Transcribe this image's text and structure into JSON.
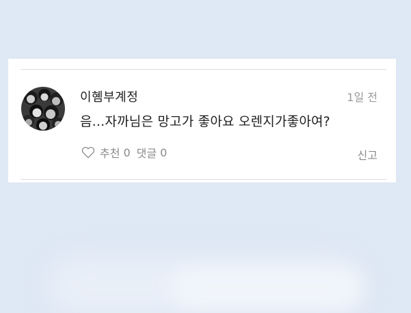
{
  "comment": {
    "username": "이혬부계정",
    "timestamp": "1일 전",
    "text": "음...자까님은 망고가 좋아요 오렌지가좋아여?",
    "avatar_icon": "group-photo-avatar"
  },
  "actions": {
    "like_icon": "heart-outline-icon",
    "like_label": "추천",
    "like_count": "0",
    "reply_label": "댓글",
    "reply_count": "0",
    "report_label": "신고"
  },
  "colors": {
    "background": "#dfe8f5",
    "card": "#ffffff",
    "username": "#222222",
    "muted": "#8a8a8a"
  }
}
